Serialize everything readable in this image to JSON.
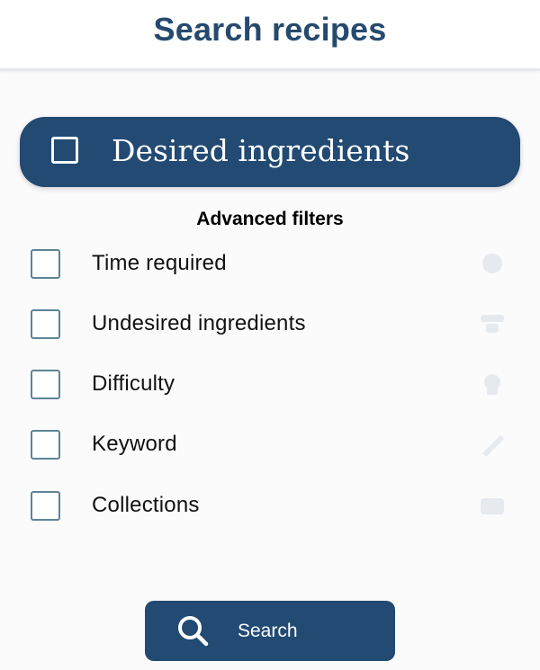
{
  "header": {
    "title": "Search recipes"
  },
  "desired": {
    "label": "Desired ingredients",
    "checked": false
  },
  "advanced": {
    "title": "Advanced filters",
    "filters": [
      {
        "label": "Time required",
        "checked": false,
        "icon": "clock-icon"
      },
      {
        "label": "Undesired ingredients",
        "checked": false,
        "icon": "ingredient-icon"
      },
      {
        "label": "Difficulty",
        "checked": false,
        "icon": "chef-hat-icon"
      },
      {
        "label": "Keyword",
        "checked": false,
        "icon": "tag-icon"
      },
      {
        "label": "Collections",
        "checked": false,
        "icon": "book-icon"
      }
    ]
  },
  "search_button": {
    "label": "Search",
    "icon": "search-icon"
  },
  "colors": {
    "primary": "#224a73",
    "title": "#264a6e",
    "checkbox_border": "#5d8496",
    "background": "#fbfbfc"
  }
}
